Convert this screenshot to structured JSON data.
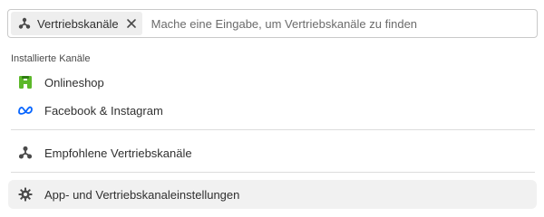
{
  "search": {
    "chip_label": "Vertriebskanäle",
    "chip_icon": "sales-channels-icon",
    "clear_icon": "close-icon",
    "placeholder": "Mache eine Eingabe, um Vertriebskanäle zu finden",
    "value": ""
  },
  "installed": {
    "heading": "Installierte Kanäle",
    "items": [
      {
        "label": "Onlineshop",
        "icon": "onlineshop-icon",
        "color": "#5cb82a"
      },
      {
        "label": "Facebook & Instagram",
        "icon": "meta-icon",
        "color": "#0866ff"
      }
    ]
  },
  "recommended": {
    "label": "Empfohlene Vertriebskanäle",
    "icon": "sales-channels-icon"
  },
  "settings": {
    "label": "App- und Vertriebskanaleinstellungen",
    "icon": "gear-icon"
  }
}
